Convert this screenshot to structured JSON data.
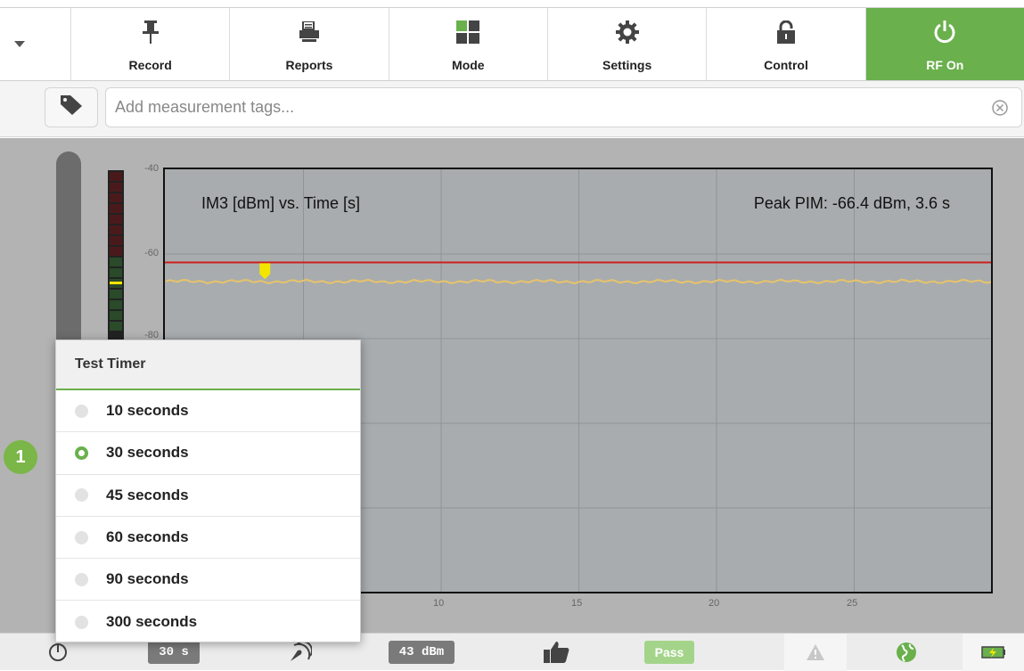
{
  "toolbar": {
    "buttons": [
      {
        "label": "Record",
        "icon": "pushpin-icon"
      },
      {
        "label": "Reports",
        "icon": "printer-icon"
      },
      {
        "label": "Mode",
        "icon": "grid-icon"
      },
      {
        "label": "Settings",
        "icon": "gear-icon"
      },
      {
        "label": "Control",
        "icon": "unlock-icon"
      },
      {
        "label": "RF On",
        "icon": "power-icon"
      }
    ]
  },
  "tags": {
    "placeholder": "Add measurement tags..."
  },
  "chart_data": {
    "type": "line",
    "title": "IM3 [dBm] vs. Time [s]",
    "annotation": "Peak PIM: -66.4 dBm, 3.6 s",
    "y_ticks": [
      "-40",
      "-60",
      "-80"
    ],
    "x_ticks": [
      "10",
      "15",
      "20",
      "25"
    ],
    "xlim": [
      0,
      30
    ],
    "ylim": [
      -40,
      -140
    ],
    "threshold": -62,
    "series": [
      {
        "values_approx": -66.5,
        "color": "#e8c36a"
      }
    ],
    "marker": {
      "x": 3.6,
      "y": -66.4
    }
  },
  "popup": {
    "title": "Test Timer",
    "options": [
      "10 seconds",
      "30 seconds",
      "45 seconds",
      "60 seconds",
      "90 seconds",
      "300 seconds"
    ],
    "selected": "30 seconds"
  },
  "callout": "1",
  "status": {
    "timer": "30 s",
    "power": "43 dBm",
    "result": "Pass"
  },
  "colors": {
    "accent": "#6ab04c",
    "threshold": "#cc1f1f",
    "trace": "#e8c36a"
  }
}
